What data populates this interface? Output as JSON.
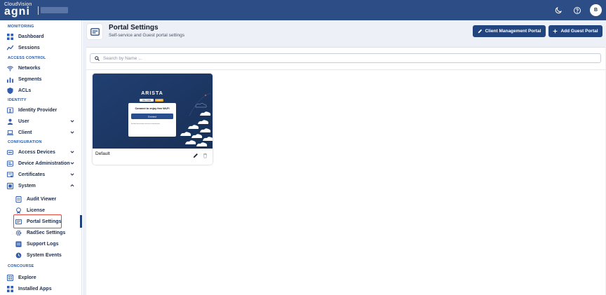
{
  "header": {
    "brand_small": "CloudVision",
    "brand_big": "agni",
    "avatar_initial": "B",
    "theme_toggle_icon": "moon-icon",
    "help_icon": "help-circle-icon"
  },
  "sidebar": {
    "sections": [
      {
        "label": "MONITORING"
      },
      {
        "label": "ACCESS CONTROL"
      },
      {
        "label": "IDENTITY"
      },
      {
        "label": "CONFIGURATION"
      },
      {
        "label": "CONCOURSE"
      }
    ],
    "items": {
      "dashboard": "Dashboard",
      "sessions": "Sessions",
      "networks": "Networks",
      "segments": "Segments",
      "acls": "ACLs",
      "identity_provider": "Identity Provider",
      "user": "User",
      "client": "Client",
      "access_devices": "Access Devices",
      "device_administration": "Device Administration",
      "certificates": "Certificates",
      "system": "System",
      "audit_viewer": "Audit Viewer",
      "license": "License",
      "portal_settings": "Portal Settings",
      "radsec_settings": "RadSec Settings",
      "support_logs": "Support Logs",
      "system_events": "System Events",
      "explore": "Explore",
      "installed_apps": "Installed Apps"
    },
    "active_item": "Portal Settings"
  },
  "page": {
    "title": "Portal Settings",
    "subtitle": "Self-service and Guest portal settings",
    "client_button": "Client Management Portal",
    "guest_button": "Add Guest Portal"
  },
  "search": {
    "placeholder": "Search by Name ...",
    "value": ""
  },
  "portal_card": {
    "name": "Default",
    "preview": {
      "logo": "ARISTA",
      "heading": "Connect to enjoy free Wi-Fi",
      "button": "Connect",
      "tag": "WELCOME",
      "badge": "GUEST",
      "fineprint": "By clicking Connect you agree to our terms of use and privacy policy"
    }
  },
  "colors": {
    "topbar": "#2d4d86",
    "primary_button": "#22457f",
    "section_label": "#2a5aa6",
    "highlight": "#e0473f",
    "main_bg": "#edf0f6"
  }
}
